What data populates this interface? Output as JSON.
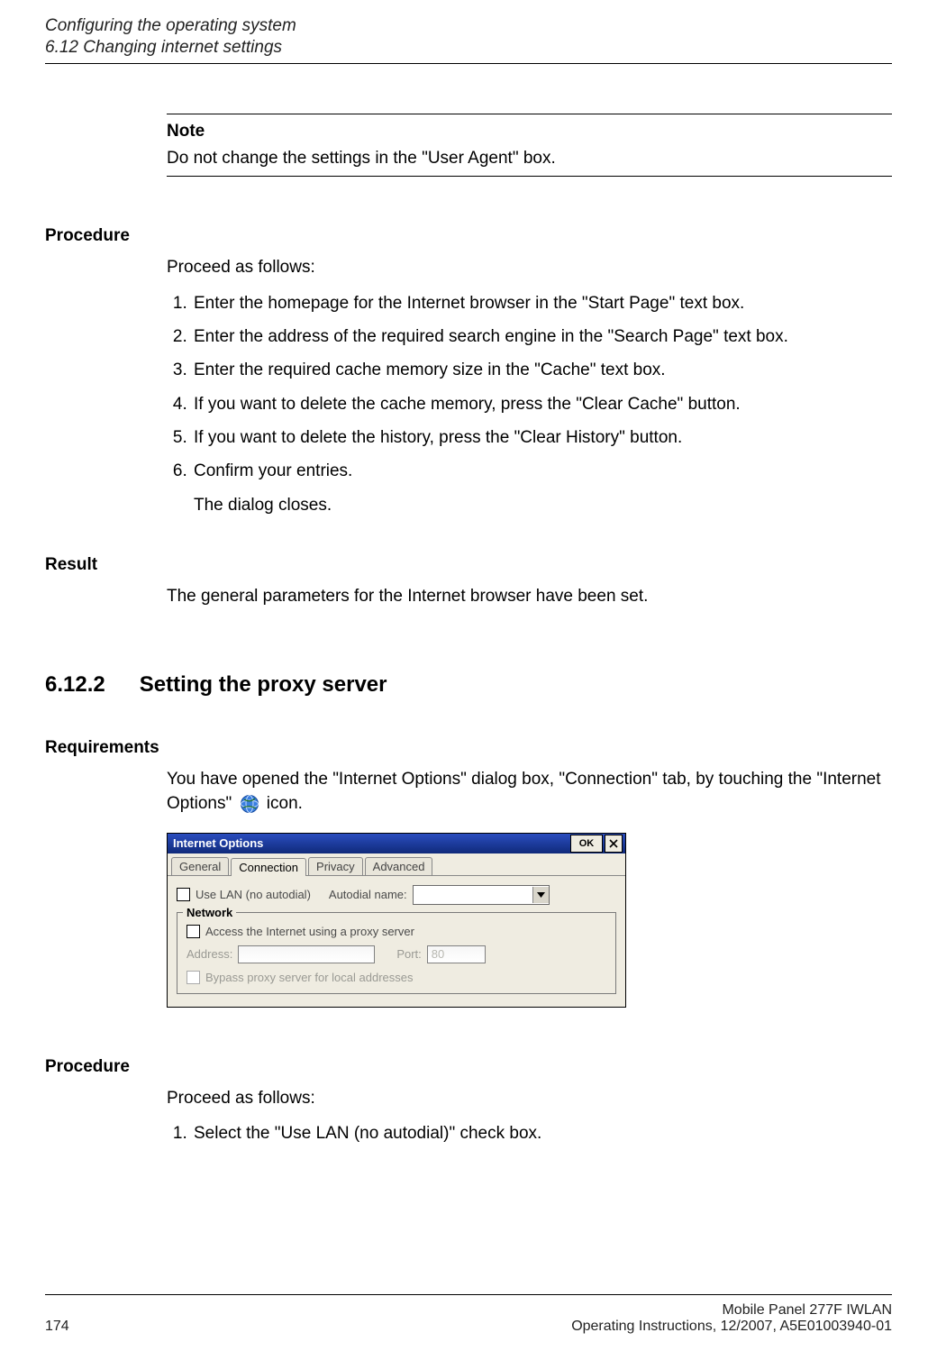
{
  "header": {
    "chapter": "Configuring the operating system",
    "section": "6.12 Changing internet settings"
  },
  "note": {
    "label": "Note",
    "text": "Do not change the settings in the \"User Agent\" box."
  },
  "procedure1": {
    "heading": "Procedure",
    "intro": "Proceed as follows:",
    "steps": [
      "Enter the homepage for the Internet browser in the \"Start Page\" text box.",
      "Enter the address of the required search engine in the \"Search Page\" text box.",
      "Enter the required cache memory size in the \"Cache\" text box.",
      "If you want to delete the cache memory, press the \"Clear Cache\" button.",
      "If you want to delete the history, press the \"Clear History\" button.",
      "Confirm your entries."
    ],
    "sub_after_last": "The dialog closes."
  },
  "result": {
    "heading": "Result",
    "text": "The general parameters for the Internet browser have been set."
  },
  "section612_2": {
    "num": "6.12.2",
    "title": "Setting the proxy server"
  },
  "requirements": {
    "heading": "Requirements",
    "text_before_icon": "You have opened the \"Internet Options\" dialog box, \"Connection\" tab, by touching the \"Internet Options\" ",
    "text_after_icon": " icon."
  },
  "dialog": {
    "title": "Internet Options",
    "ok": "OK",
    "tabs": [
      "General",
      "Connection",
      "Privacy",
      "Advanced"
    ],
    "active_tab": 1,
    "use_lan_label": "Use LAN (no autodial)",
    "autodial_label": "Autodial name:",
    "network_legend": "Network",
    "proxy_label": "Access the Internet using a proxy server",
    "address_label": "Address:",
    "port_label": "Port:",
    "port_value": "80",
    "bypass_label": "Bypass proxy server for local addresses"
  },
  "procedure2": {
    "heading": "Procedure",
    "intro": "Proceed as follows:",
    "steps": [
      "Select the \"Use LAN (no autodial)\" check box."
    ]
  },
  "footer": {
    "page": "174",
    "doc": "Mobile Panel 277F IWLAN",
    "info": "Operating Instructions, 12/2007, A5E01003940-01"
  }
}
